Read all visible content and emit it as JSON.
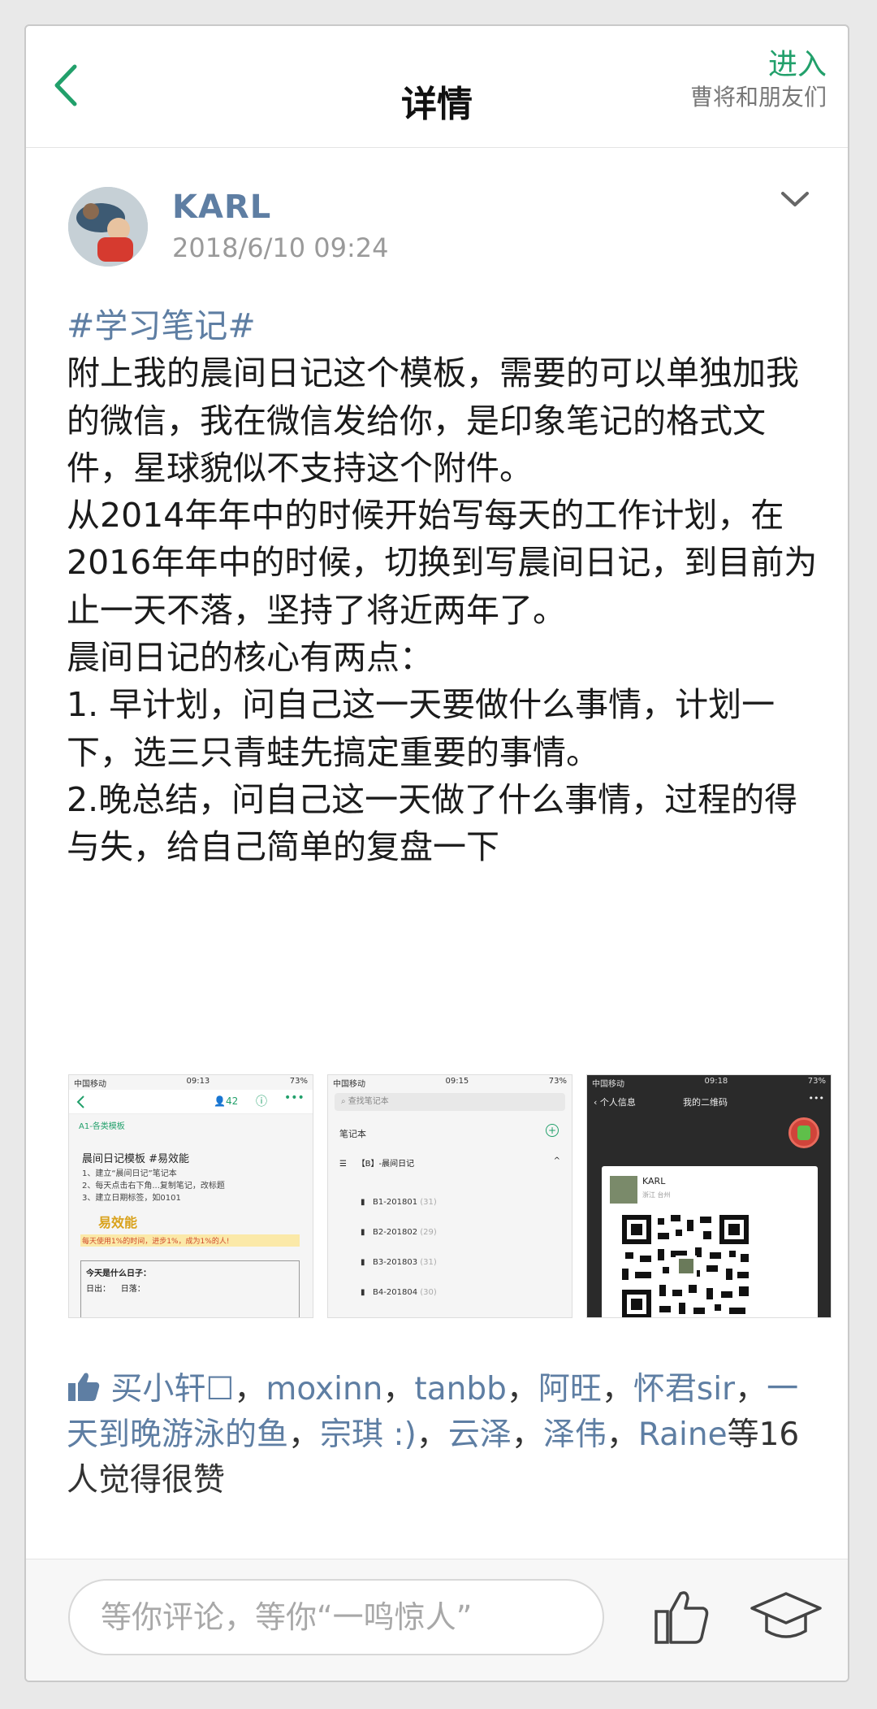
{
  "nav": {
    "title": "详情",
    "enter_label": "进入",
    "group_name": "曹将和朋友们"
  },
  "post": {
    "author": "KARL",
    "time": "2018/6/10 09:24",
    "hashtag": "#学习笔记#",
    "paragraphs": [
      "附上我的晨间日记这个模板，需要的可以单独加我的微信，我在微信发给你，是印象笔记的格式文件，星球貌似不支持这个附件。",
      "从2014年年中的时候开始写每天的工作计划，在2016年年中的时候，切换到写晨间日记，到目前为止一天不落，坚持了将近两年了。",
      "晨间日记的核心有两点：",
      "1. 早计划，问自己这一天要做什么事情，计划一下，选三只青蛙先搞定重要的事情。",
      "2.晚总结，问自己这一天做了什么事情，过程的得与失，给自己简单的复盘一下"
    ]
  },
  "thumbs": {
    "t1": {
      "status_left": "中国移动",
      "status_time": "09:13",
      "status_right": "73%",
      "like_count": "42",
      "notebook": "A1-各类模板",
      "heading": "晨间日记模板 #易效能",
      "steps": [
        "1、建立“晨间日记”笔记本",
        "2、每天点击右下角...复制笔记，改标题",
        "3、建立日期标签，如0101"
      ],
      "brand": "易效能",
      "slogan": "每天使用1%的时间，进步1%，成为1%的人!",
      "box_title": "今天是什么日子：",
      "box_row": [
        "日出：",
        "日落："
      ]
    },
    "t2": {
      "status_left": "中国移动",
      "status_time": "09:15",
      "status_right": "73%",
      "search_placeholder": "查找笔记本",
      "section": "笔记本",
      "group": "【B】-晨间日记",
      "items": [
        {
          "name": "B1-201801",
          "count": "(31)"
        },
        {
          "name": "B2-201802",
          "count": "(29)"
        },
        {
          "name": "B3-201803",
          "count": "(31)"
        },
        {
          "name": "B4-201804",
          "count": "(30)"
        }
      ]
    },
    "t3": {
      "status_left": "中国移动",
      "status_time": "09:18",
      "status_right": "73%",
      "back_label": "个人信息",
      "title": "我的二维码",
      "card_name": "KARL",
      "card_region": "浙江 台州"
    }
  },
  "likes": {
    "names": [
      "买小轩☐",
      "moxinn",
      "tanbb",
      "阿旺",
      "怀君sir",
      "一天到晚游泳的鱼",
      "宗琪 :)",
      "云泽",
      "泽伟",
      "Raine"
    ],
    "separator": "，",
    "suffix": "等16人觉得很赞"
  },
  "bottom": {
    "comment_placeholder": "等你评论，等你“一鸣惊人”"
  },
  "colors": {
    "accent_green": "#22a06b",
    "link_blue": "#5e7ea3"
  }
}
